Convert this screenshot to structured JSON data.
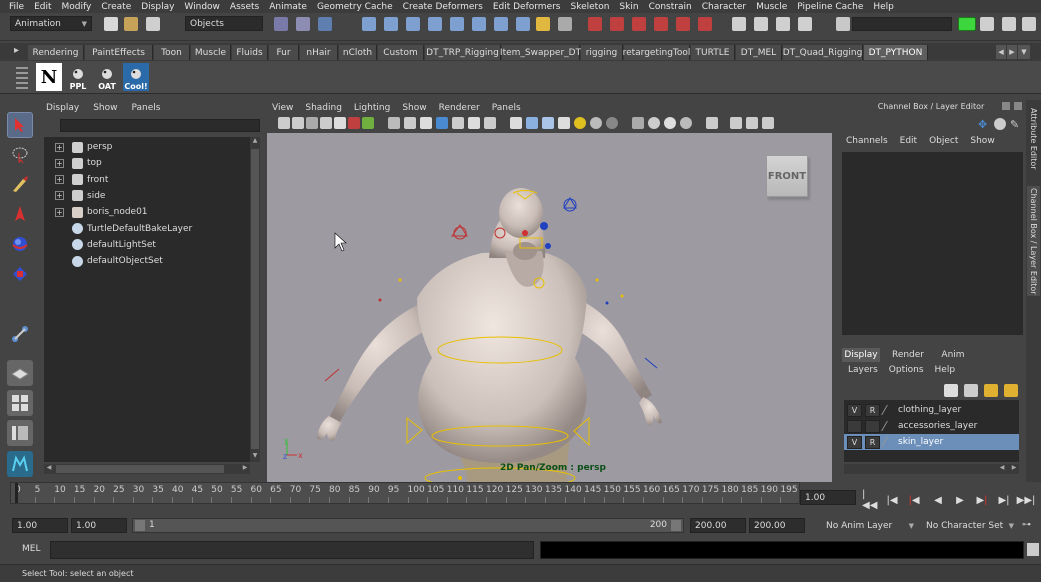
{
  "menu": [
    "File",
    "Edit",
    "Modify",
    "Create",
    "Display",
    "Window",
    "Assets",
    "Animate",
    "Geometry Cache",
    "Create Deformers",
    "Edit Deformers",
    "Skeleton",
    "Skin",
    "Constrain",
    "Character",
    "Muscle",
    "Pipeline Cache",
    "Help"
  ],
  "status": {
    "menu_set": "Animation",
    "selection_mode": "Objects"
  },
  "shelf": {
    "tabs": [
      "Rendering",
      "PaintEffects",
      "Toon",
      "Muscle",
      "Fluids",
      "Fur",
      "nHair",
      "nCloth",
      "Custom",
      "DT_TRP_Rigging",
      "Item_Swapper_DT",
      "rigging",
      "retargetingTool",
      "TURTLE",
      "DT_MEL",
      "DT_Quad_Rigging",
      "DT_PYTHON"
    ],
    "active_tab": "DT_PYTHON",
    "buttons": [
      {
        "label": "",
        "icon": "n-logo-icon"
      },
      {
        "label": "PPL",
        "icon": "python-icon"
      },
      {
        "label": "OAT",
        "icon": "python-icon"
      },
      {
        "label": "Cool!",
        "icon": "python-blue-icon"
      }
    ]
  },
  "outliner": {
    "menu": [
      "Display",
      "Show",
      "Panels"
    ],
    "items": [
      {
        "label": "persp",
        "expandable": true,
        "icon": "camera-icon"
      },
      {
        "label": "top",
        "expandable": true,
        "icon": "camera-icon"
      },
      {
        "label": "front",
        "expandable": true,
        "icon": "camera-icon"
      },
      {
        "label": "side",
        "expandable": true,
        "icon": "camera-icon"
      },
      {
        "label": "boris_node01",
        "expandable": true,
        "icon": "transform-icon"
      },
      {
        "label": "TurtleDefaultBakeLayer",
        "expandable": false,
        "icon": "set-icon"
      },
      {
        "label": "defaultLightSet",
        "expandable": false,
        "icon": "set-icon"
      },
      {
        "label": "defaultObjectSet",
        "expandable": false,
        "icon": "set-icon"
      }
    ]
  },
  "viewport": {
    "menu": [
      "View",
      "Shading",
      "Lighting",
      "Show",
      "Renderer",
      "Panels"
    ],
    "cube_label": "FRONT",
    "hud_label": "2D Pan/Zoom : persp",
    "axis_x": "x",
    "axis_y": "y",
    "axis_z": "z"
  },
  "channel_box": {
    "title": "Channel Box / Layer Editor",
    "menu": [
      "Channels",
      "Edit",
      "Object",
      "Show"
    ]
  },
  "layer_editor": {
    "tabs": [
      "Display",
      "Render",
      "Anim"
    ],
    "active_tab": "Display",
    "menu": [
      "Layers",
      "Options",
      "Help"
    ],
    "layers": [
      {
        "v": "V",
        "r": "R",
        "name": "clothing_layer",
        "selected": false
      },
      {
        "v": "",
        "r": "",
        "name": "accessories_layer",
        "selected": false
      },
      {
        "v": "V",
        "r": "R",
        "name": "skin_layer",
        "selected": true
      }
    ]
  },
  "side_tabs": [
    "Attribute Editor",
    "Channel Box / Layer Editor"
  ],
  "time_slider": {
    "ticks": [
      0,
      5,
      10,
      15,
      20,
      25,
      30,
      35,
      40,
      45,
      50,
      55,
      60,
      65,
      70,
      75,
      80,
      85,
      90,
      95,
      100,
      105,
      110,
      115,
      120,
      125,
      130,
      135,
      140,
      145,
      150,
      155,
      160,
      165,
      170,
      175,
      180,
      185,
      190,
      195
    ],
    "current_time": "1.00"
  },
  "range_slider": {
    "start_time": "1.00",
    "playback_start": "1.00",
    "range_start_label": "1",
    "range_end_label": "200",
    "playback_end": "200.00",
    "end_time": "200.00",
    "anim_layer": "No Anim Layer",
    "character_set": "No Character Set"
  },
  "command_line": {
    "label": "MEL",
    "input_value": ""
  },
  "help_line": "Select Tool: select an object",
  "colors": {
    "viewport_bg": "#9d9aa2",
    "selection": "#6b8fb8",
    "highlight_green": "#3dd63d"
  }
}
